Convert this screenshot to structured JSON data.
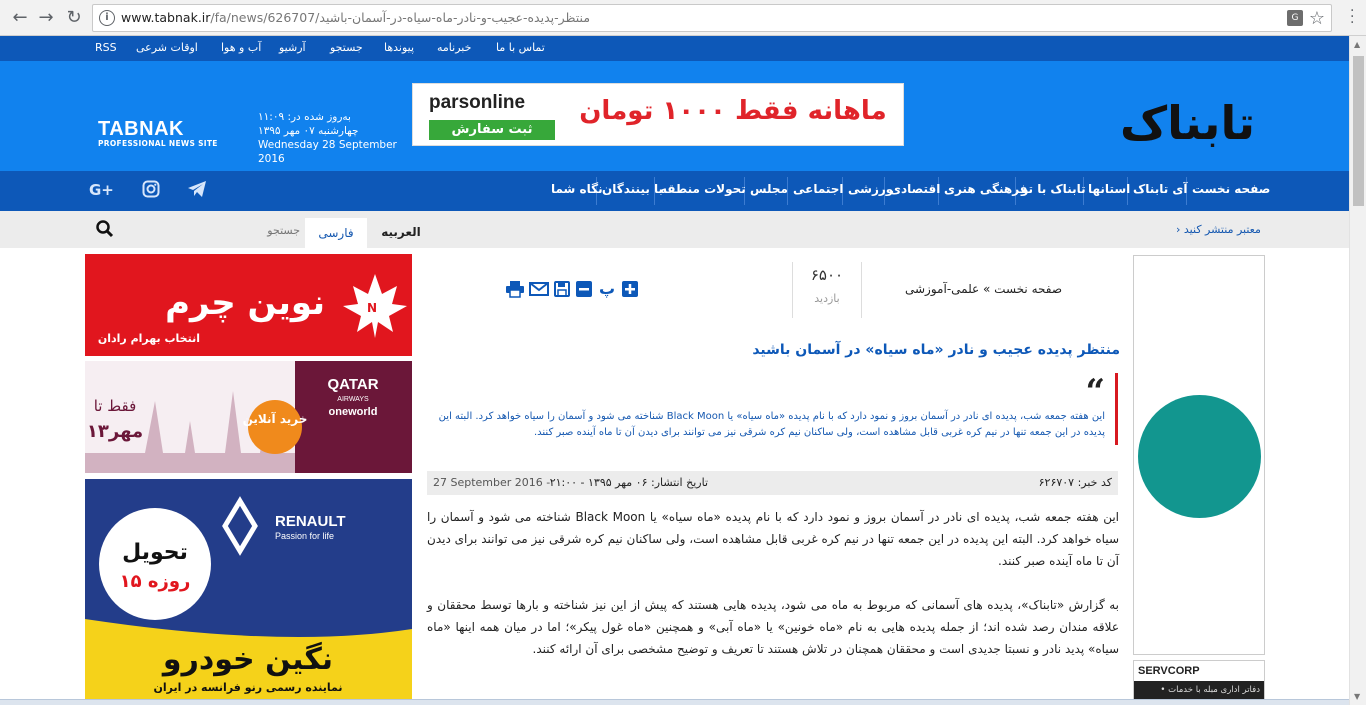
{
  "browser": {
    "url_host": "www.tabnak.ir",
    "url_path": "/fa/news/626707/منتظر-پدیده-عجیب-و-نادر-ماه-سیاه-در-آسمان-باشید"
  },
  "topstrip": {
    "links": [
      "تماس با ما",
      "خبرنامه",
      "پیوندها",
      "جستجو",
      "آرشیو",
      "آب و هوا",
      "اوقات شرعی",
      "RSS"
    ]
  },
  "header": {
    "logo_fa": "تابناک",
    "banner": {
      "brand": "parsonline",
      "cta": "ثبت سفارش",
      "offer": "ماهانه فقط ۱۰۰۰ تومان"
    },
    "date": {
      "updated": "به‌روز شده در: ۱۱:۰۹",
      "fa_date": "چهارشنبه ۰۷ مهر ۱۳۹۵",
      "en_date": "Wednesday 28 September 2016"
    },
    "logo_en": "TABNAK",
    "logo_en_sub": "PROFESSIONAL NEWS SITE"
  },
  "mainnav": {
    "items": [
      "صفحه نخست",
      "آی تابناک",
      "استانها",
      "تابناک با تو",
      "فرهنگی هنری",
      "اقتصادی",
      "ورزشی",
      "اجتماعی",
      "مجلس",
      "تحولات منطقه",
      "با بینندگان",
      "نگاه شما"
    ],
    "social": [
      "telegram-icon",
      "instagram-icon",
      "google-plus-icon"
    ]
  },
  "subbar": {
    "ticker": "› معتبر منتشر کنید",
    "lang_ar": "العربیه",
    "lang_fa": "فارسی",
    "search_placeholder": "جستجو"
  },
  "ads": {
    "novin": {
      "title": "نوین چرم",
      "sub": "انتخاب بهرام رادان"
    },
    "qatar": {
      "brand": "QATAR",
      "sub": "AIRWAYS",
      "alliance": "oneworld",
      "badge": "خرید آنلاین",
      "price_1": "فقط تا",
      "price_2": "۱۳مهر"
    },
    "renault": {
      "brand": "RENAULT",
      "tagline": "Passion for life",
      "delivery_1": "تحویل",
      "delivery_2": "۱۵ روزه",
      "dealer": "نگین خودرو",
      "dealer_sub": "نماینده رسمی رنو فرانسه در ایران"
    }
  },
  "article": {
    "breadcrumb": "صفحه نخست » علمی-آموزشی",
    "visits_count": "۶۵۰۰",
    "visits_label": "بازدید",
    "tools": [
      "plus-icon",
      "پ",
      "minus-icon",
      "save-icon",
      "email-icon",
      "print-icon"
    ],
    "headline": "منتظر پدیده عجیب و نادر «ماه سیاه» در آسمان باشید",
    "lead": "این هفته جمعه شب، پدیده ای نادر در آسمان بروز و نمود دارد که با نام پدیده «ماه سیاه» یا Black Moon شناخته می شود و آسمان را سیاه خواهد کرد. البته این پدیده در این جمعه تنها در نیم کره غربی قابل مشاهده است، ولی ساکنان نیم کره شرقی نیز می توانند برای دیدن آن تا ماه آینده صبر کنند.",
    "code": "کد خبر: ۶۲۶۷۰۷",
    "pub_date": "تاریخ انتشار: ۰۶ مهر ۱۳۹۵ - ۲۱:۰۰",
    "pub_date_en": "27 September 2016  -",
    "paragraphs": [
      "این هفته جمعه شب، پدیده ای نادر در آسمان بروز و نمود دارد که با نام پدیده «ماه سیاه» یا Black Moon شناخته می شود و آسمان را سیاه خواهد کرد. البته این پدیده در این جمعه تنها در نیم کره غربی قابل مشاهده است، ولی ساکنان نیم کره شرقی نیز می توانند برای دیدن آن تا ماه آینده صبر کنند.",
      "به گزارش «تابناک»، پدیده های آسمانی که مربوط به ماه می شود، پدیده هایی هستند که پیش از این نیز شناخته و بارها توسط محققان و علاقه مندان رصد شده اند؛ از جمله پدیده هایی به نام «ماه خونین» یا «ماه آبی» و همچنین «ماه غول پیکر»؛ اما در میان همه اینها «ماه سیاه» پدید نادر و نسبتا جدیدی است و محققان همچنان در تلاش هستند تا تعریف و توضیح مشخصی برای آن ارائه کنند."
    ]
  },
  "right": {
    "servcorp": "SERVCORP",
    "servcorp_sub": "• دفاتر اداری مبله با خدمات"
  },
  "colors": {
    "header_blue": "#1182ee",
    "nav_blue": "#0d58b8",
    "accent_red": "#d71920",
    "teal": "#12968f"
  }
}
